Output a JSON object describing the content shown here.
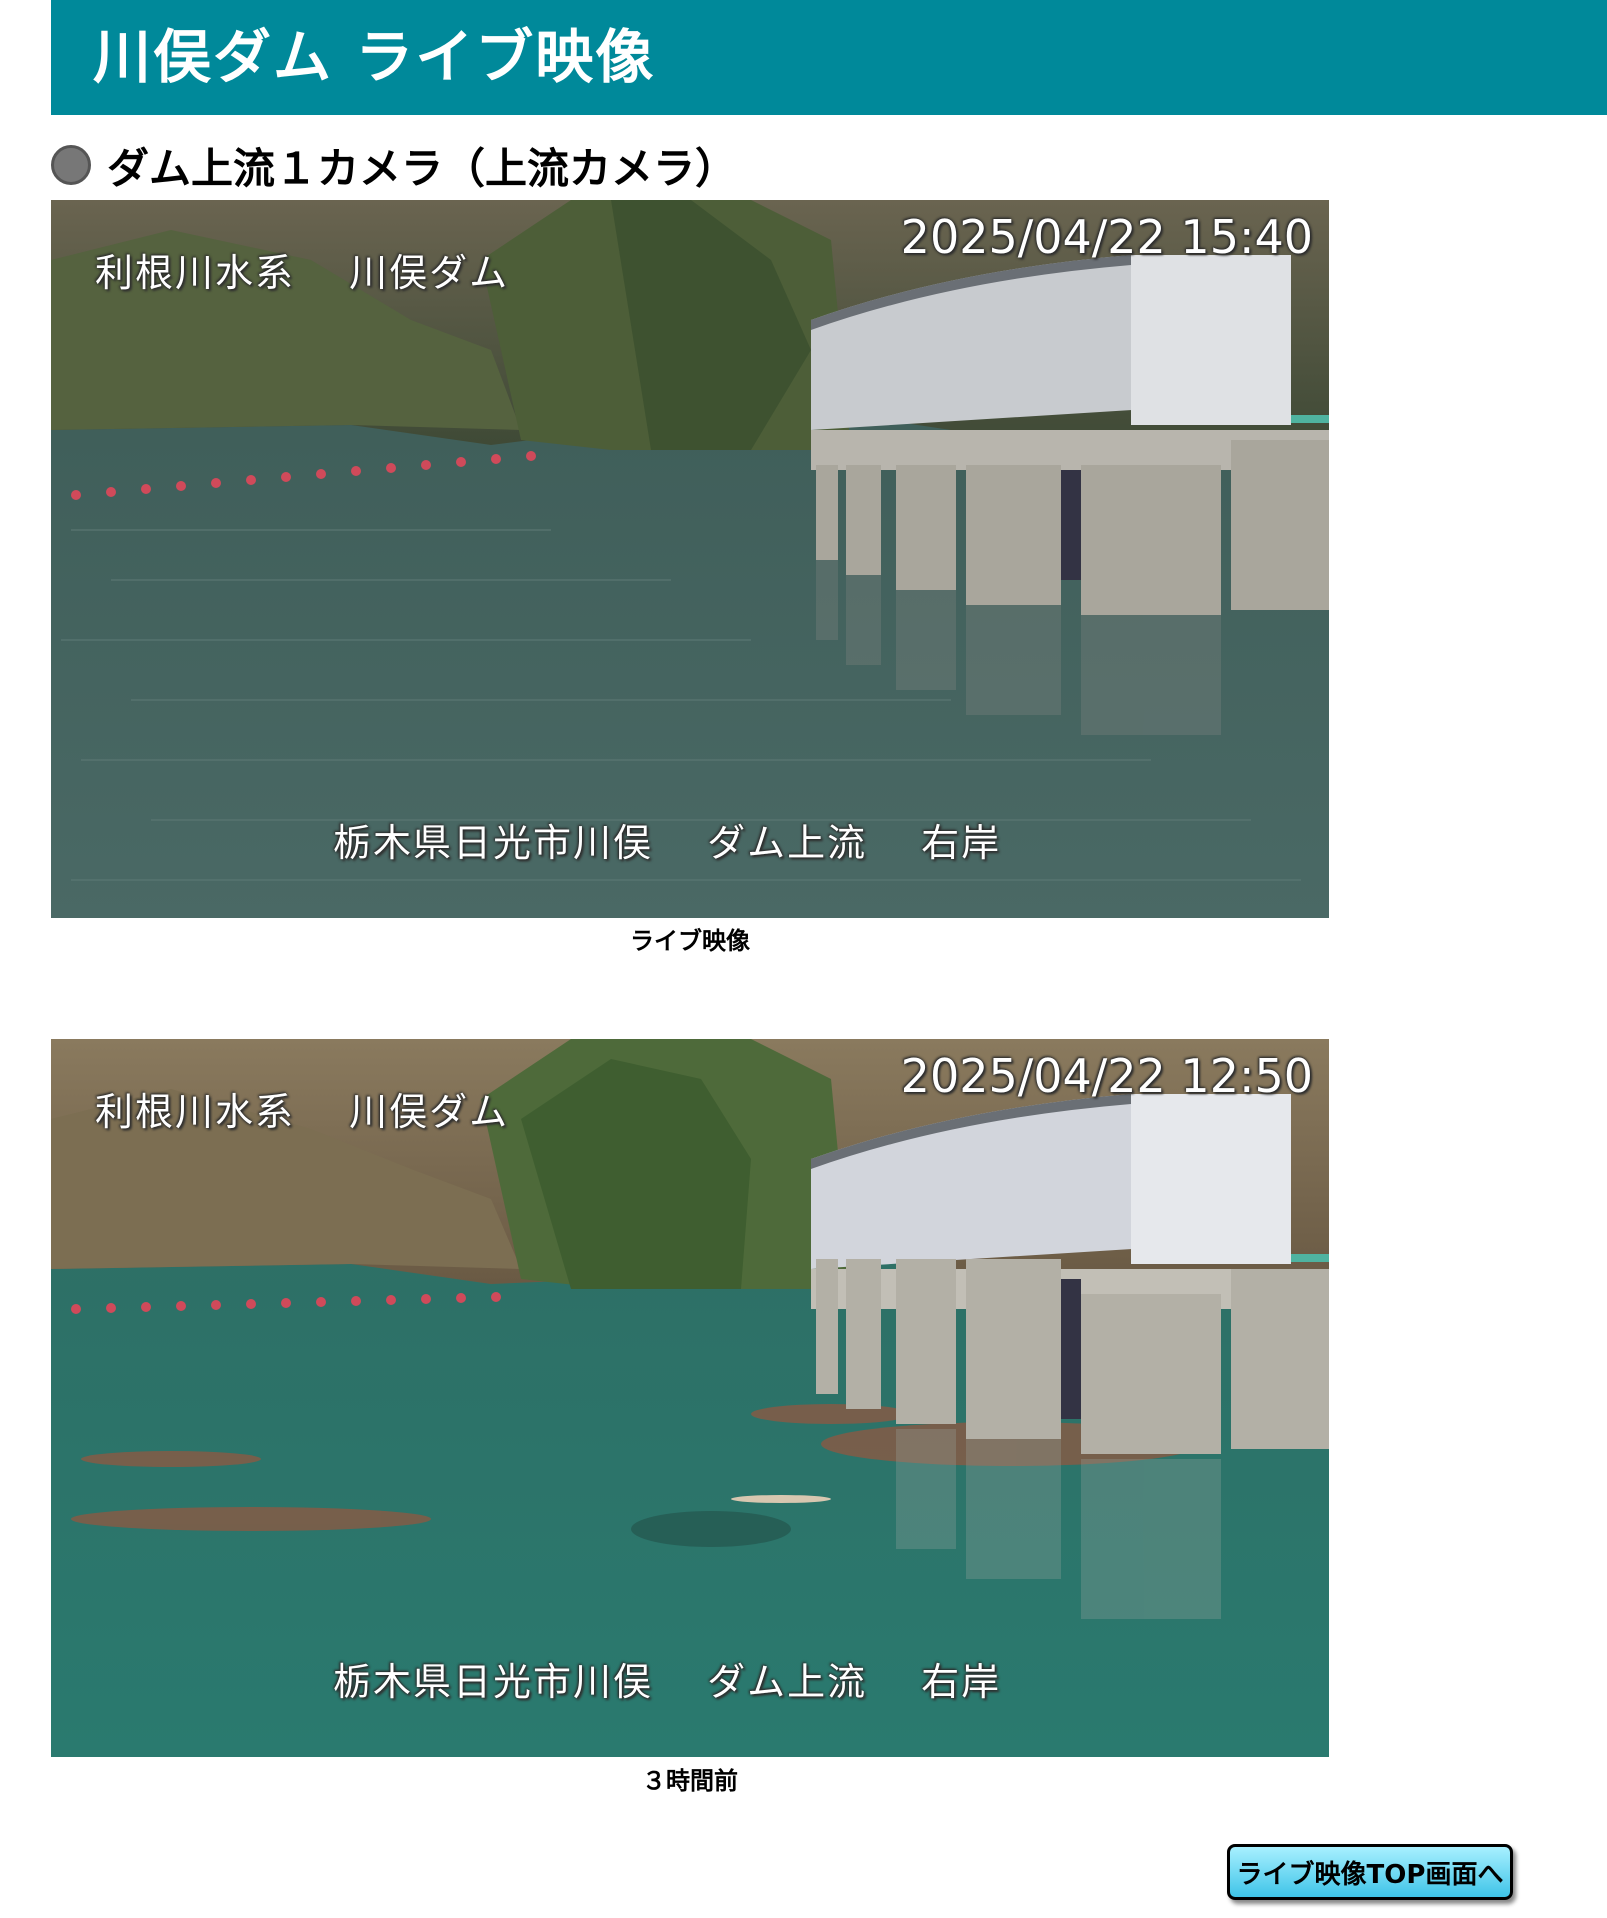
{
  "page": {
    "title": "川俣ダム ライブ映像"
  },
  "section": {
    "heading": "ダム上流１カメラ（上流カメラ）"
  },
  "cameras": [
    {
      "system_label": "利根川水系　 川俣ダム",
      "timestamp": "2025/04/22 15:40",
      "location_label": "栃木県日光市川俣　 ダム上流　 右岸",
      "caption": "ライブ映像"
    },
    {
      "system_label": "利根川水系　 川俣ダム",
      "timestamp": "2025/04/22 12:50",
      "location_label": "栃木県日光市川俣　 ダム上流　 右岸",
      "caption": "３時間前"
    }
  ],
  "nav": {
    "top_button_label": "ライブ映像TOP画面へ"
  },
  "colors": {
    "banner": "#00899a",
    "button_gradient_top": "#a8f0ff",
    "button_gradient_bottom": "#3fc4e8"
  }
}
